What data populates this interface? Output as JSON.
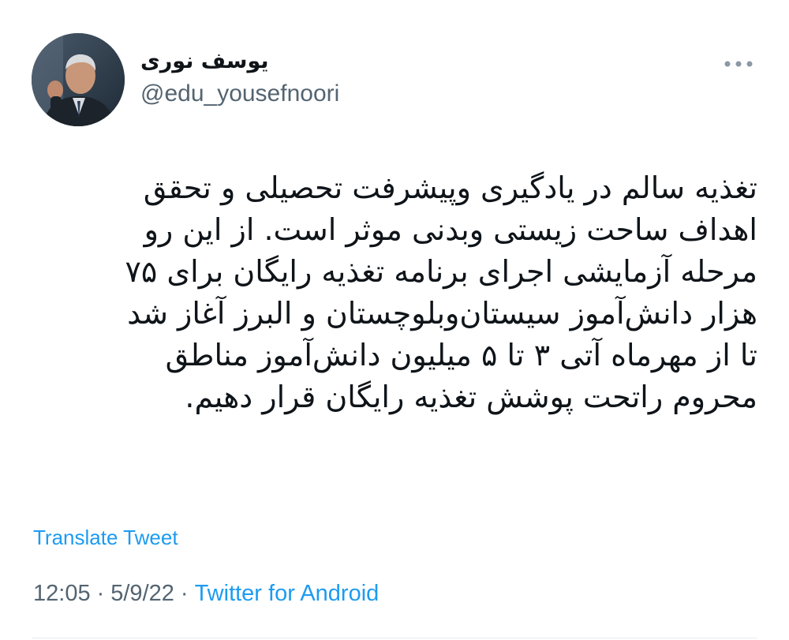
{
  "user": {
    "display_name": "یوسف نوری",
    "handle": "@edu_yousefnoori"
  },
  "tweet": {
    "lines": [
      "تغذیه سالم در یادگیری وپیشرفت تحصیلی و تحقق",
      "اهداف ساحت زیستی وبدنی موثر است. از این رو",
      "مرحله آزمایشی اجرای برنامه تغذیه رایگان برای ۷۵",
      "هزار دانش‌آموز سیستان‌وبلوچستان و البرز آغاز شد",
      "تا از مهرماه آتی ۳ تا ۵ میلیون دانش‌آموز مناطق",
      "محروم راتحت پوشش تغذیه رایگان قرار دهیم."
    ]
  },
  "actions": {
    "translate_label": "Translate Tweet"
  },
  "meta": {
    "time": "12:05",
    "separator": "·",
    "date": "5/9/22",
    "source": "Twitter for Android"
  },
  "icons": {
    "more": "more-horizontal-icon"
  },
  "colors": {
    "link": "#1d9bf0",
    "secondary_text": "#536471",
    "primary_text": "#0f1419"
  }
}
